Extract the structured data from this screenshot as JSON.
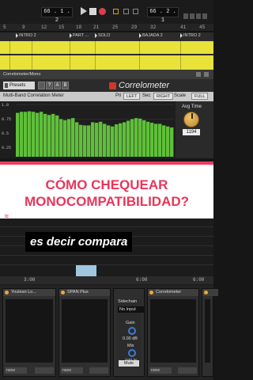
{
  "transport": {
    "position_left": "66 . 1 . 2",
    "position_right": "66 . 2 . 1"
  },
  "ruler": {
    "marks": [
      "5",
      "9",
      "12",
      "15",
      "18",
      "21",
      "25",
      "29",
      "32",
      "41",
      "45"
    ]
  },
  "locators": [
    {
      "label": "INTRO 2"
    },
    {
      "label": "PART ..."
    },
    {
      "label": "SOLO"
    },
    {
      "label": "BAJADA 2"
    },
    {
      "label": "INTRO 2"
    }
  ],
  "plugin": {
    "window_title": "Correlometer/Mono",
    "presets_label": "Presets",
    "toolbar_icons": [
      "?",
      "A",
      "B"
    ],
    "brand": "Correlometer",
    "panel_title": "Multi-Band Correlation Meter",
    "header": {
      "pri_label": "Pri",
      "left_label": "LEFT",
      "sec_label": "Sec",
      "right_label": "RIGHT",
      "scale_label": "Scale",
      "full_label": "FULL"
    },
    "y_axis": [
      "1.0",
      "0.75",
      "0.5",
      "0.25"
    ],
    "avg_time_label": "Avg Time",
    "avg_time_value": "1194",
    "band_values": [
      0.84,
      0.86,
      0.86,
      0.87,
      0.86,
      0.84,
      0.86,
      0.82,
      0.8,
      0.82,
      0.79,
      0.72,
      0.7,
      0.72,
      0.74,
      0.66,
      0.61,
      0.6,
      0.6,
      0.66,
      0.65,
      0.67,
      0.63,
      0.6,
      0.58,
      0.62,
      0.64,
      0.66,
      0.69,
      0.72,
      0.74,
      0.73,
      0.7,
      0.67,
      0.65,
      0.63,
      0.63,
      0.6,
      0.58,
      0.56
    ],
    "colors": {
      "accent": "#c83a2b",
      "bars": "#5fbf3a"
    }
  },
  "banner": {
    "line1": "CÓMO CHEQUEAR",
    "line2": "MONOCOMPATIBILIDAD?",
    "mark": "≈",
    "colors": {
      "text": "#e8365a",
      "border": "#ef3b5d"
    }
  },
  "caption": "es decir compara",
  "timeline": {
    "marks": [
      "3:00",
      "6:00",
      "6:00"
    ]
  },
  "devices": [
    {
      "title": "Youlean Lo...",
      "foot": "none"
    },
    {
      "title": "SPAN Plus",
      "foot": "none"
    },
    {
      "title": "Correlometer",
      "utility": {
        "sidechain_label": "Sidechain",
        "input_value": "No Input",
        "gain_label": "Gain",
        "gain_value": "0.00 dB",
        "mix_label": "Mix",
        "mix_value": "100 %",
        "mute_label": "Mute"
      },
      "foot": "none"
    },
    {
      "title": "",
      "foot": "none"
    }
  ]
}
